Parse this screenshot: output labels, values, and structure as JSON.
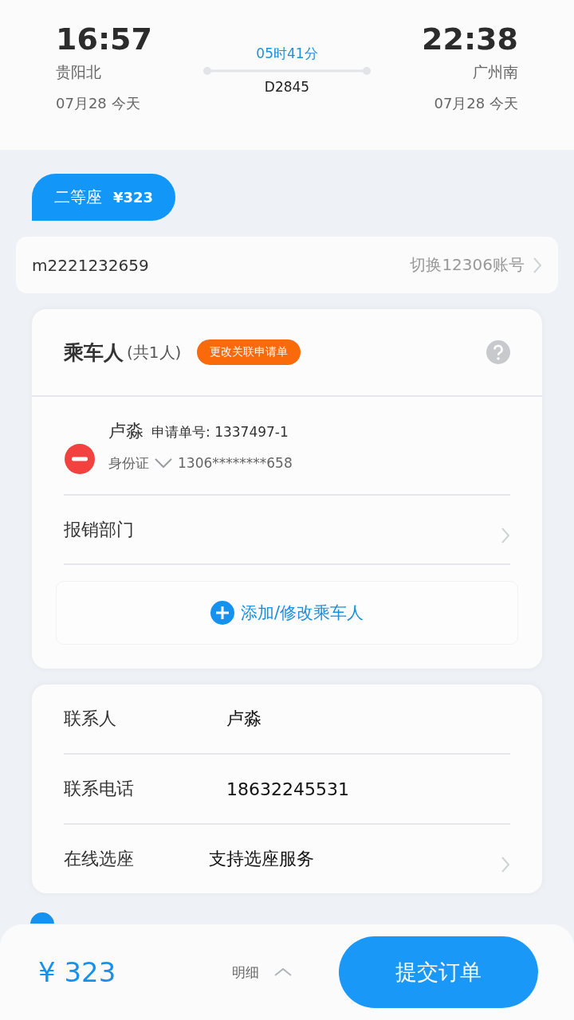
{
  "trip": {
    "depart_time": "16:57",
    "depart_station": "贵阳北",
    "depart_date": "07月28 今天",
    "duration": "05时41分",
    "train_no": "D2845",
    "arrive_time": "22:38",
    "arrive_station": "广州南",
    "arrive_date": "07月28 今天"
  },
  "seat_tabs": [
    {
      "label": "二等座",
      "price": "¥323",
      "selected": true
    }
  ],
  "account": {
    "id": "m2221232659",
    "action": "切换12306账号"
  },
  "passengers_card": {
    "title": "乘车人",
    "count": "(共1人)",
    "badge": "更改关联申请单",
    "passengers": [
      {
        "name": "卢淼",
        "request_label": "申请单号:",
        "request_no": "1337497-1",
        "id_type": "身份证",
        "id_no": "1306********658"
      }
    ],
    "department_label": "报销部门",
    "add_button": "添加/修改乘车人"
  },
  "contact_rows": [
    {
      "label": "联系人",
      "value": "卢淼",
      "kind": "plain"
    },
    {
      "label": "联系电话",
      "value": "18632245531",
      "kind": "plain"
    },
    {
      "label": "在线选座",
      "value": "支持选座服务",
      "kind": "link"
    }
  ],
  "bottom_bar": {
    "total": "¥ 323",
    "details": "明细",
    "submit": "提交订单"
  }
}
